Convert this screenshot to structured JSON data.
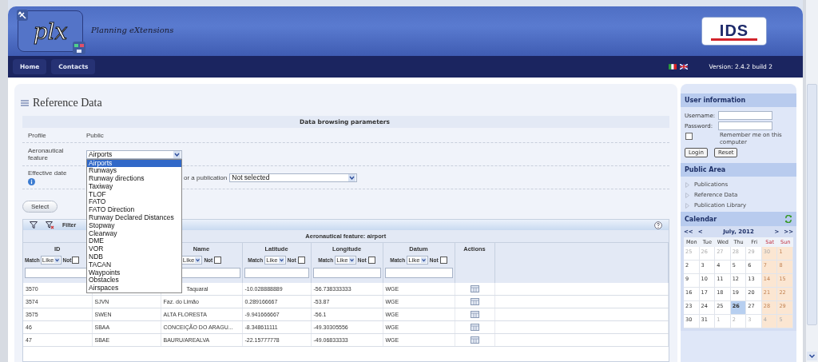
{
  "header": {
    "logo": "plx",
    "tagline": "Planning eXtensions",
    "brand": "IDS"
  },
  "nav": [
    {
      "label": "Home"
    },
    {
      "label": "Contacts"
    }
  ],
  "version": "Version: 2.4.2 build 2",
  "page_title": "Reference Data",
  "params": {
    "title": "Data browsing parameters",
    "profile_label": "Profile",
    "profile_value": "Public",
    "feature_label": "Aeronautical feature",
    "feature_value": "Airports",
    "feature_options": [
      {
        "label": "Airports",
        "selected": true
      },
      {
        "label": "Runways",
        "selected": false
      },
      {
        "label": "Runway directions",
        "selected": false
      },
      {
        "label": "Taxiway",
        "selected": false
      },
      {
        "label": "TLOF",
        "selected": false
      },
      {
        "label": "FATO",
        "selected": false
      },
      {
        "label": "FATO Direction",
        "selected": false
      },
      {
        "label": "Runway Declared Distances",
        "selected": false
      },
      {
        "label": "Stopway",
        "selected": false
      },
      {
        "label": "Clearway",
        "selected": false
      },
      {
        "label": "DME",
        "selected": false
      },
      {
        "label": "VOR",
        "selected": false
      },
      {
        "label": "NDB",
        "selected": false
      },
      {
        "label": "TACAN",
        "selected": false
      },
      {
        "label": "Waypoints",
        "selected": false
      },
      {
        "label": "Obstacles",
        "selected": false
      },
      {
        "label": "Airspaces",
        "selected": false
      }
    ],
    "date_label": "Effective date",
    "publication_label": "or a publication",
    "publication_value": "Not selected",
    "select_button": "Select"
  },
  "table": {
    "toolbar_label": "Filter",
    "caption": "Aeronautical feature: airport",
    "columns": [
      {
        "title": "ID",
        "filter": {
          "match": "Match",
          "op": "Like",
          "not": "Not",
          "not_checked": false
        }
      },
      {},
      {
        "title": "Name",
        "filter": {
          "op": "Like",
          "not": "Not",
          "not_checked": false
        }
      },
      {
        "title": "Latitude",
        "filter": {
          "match": "Match",
          "op": "Like",
          "not": "Not",
          "not_checked": false
        }
      },
      {
        "title": "Longitude",
        "filter": {
          "match": "Match",
          "op": "Like",
          "not": "Not",
          "not_checked": false
        }
      },
      {
        "title": "Datum",
        "filter": {
          "match": "Match",
          "op": "Like",
          "not": "Not",
          "not_checked": false
        }
      },
      {
        "title": "Actions"
      }
    ],
    "rows": [
      {
        "cells": [
          "3570",
          "",
          "Taquaral",
          "-10.028888889",
          "-56.738333333",
          "WGE"
        ]
      },
      {
        "cells": [
          "3574",
          "SJVN",
          "Faz. do Limão",
          "0.289166667",
          "-53.87",
          "WGE"
        ]
      },
      {
        "cells": [
          "3575",
          "SWEN",
          "ALTA FLORESTA",
          "-9.941666667",
          "-56.1",
          "WGE"
        ]
      },
      {
        "cells": [
          "46",
          "SBAA",
          "CONCEIÇÃO DO ARAGU...",
          "-8.348611111",
          "-49.30305556",
          "WGE"
        ]
      },
      {
        "cells": [
          "47",
          "SBAE",
          "BAURU/AREALVA",
          "-22.15777778",
          "-49.06833333",
          "WGE"
        ]
      }
    ]
  },
  "user_info": {
    "title": "User information",
    "username_label": "Username:",
    "password_label": "Password:",
    "remember": "Remember me on this computer",
    "remember_checked": false,
    "login": "Login",
    "reset": "Reset"
  },
  "public_area": {
    "title": "Public Area",
    "links": [
      "Publications",
      "Reference Data",
      "Publication Library"
    ]
  },
  "calendar": {
    "title": "Calendar",
    "first": "<<",
    "prev": "<",
    "month": "July, 2012",
    "next": ">",
    "last": ">>",
    "weekdays": [
      "Mon",
      "Tue",
      "Wed",
      "Thu",
      "Fri",
      "Sat",
      "Sun"
    ],
    "weeks": [
      [
        {
          "d": "25",
          "other": true,
          "selected": false
        },
        {
          "d": "26",
          "other": true,
          "selected": false
        },
        {
          "d": "27",
          "other": true,
          "selected": false
        },
        {
          "d": "28",
          "other": true,
          "selected": false
        },
        {
          "d": "29",
          "other": true,
          "selected": false
        },
        {
          "d": "30",
          "other": true,
          "selected": false
        },
        {
          "d": "1",
          "other": false,
          "selected": false
        }
      ],
      [
        {
          "d": "2",
          "other": false,
          "selected": false
        },
        {
          "d": "3",
          "other": false,
          "selected": false
        },
        {
          "d": "4",
          "other": false,
          "selected": false
        },
        {
          "d": "5",
          "other": false,
          "selected": false
        },
        {
          "d": "6",
          "other": false,
          "selected": false
        },
        {
          "d": "7",
          "other": false,
          "selected": false
        },
        {
          "d": "8",
          "other": false,
          "selected": false
        }
      ],
      [
        {
          "d": "9",
          "other": false,
          "selected": false
        },
        {
          "d": "10",
          "other": false,
          "selected": false
        },
        {
          "d": "11",
          "other": false,
          "selected": false
        },
        {
          "d": "12",
          "other": false,
          "selected": false
        },
        {
          "d": "13",
          "other": false,
          "selected": false
        },
        {
          "d": "14",
          "other": false,
          "selected": false
        },
        {
          "d": "15",
          "other": false,
          "selected": false
        }
      ],
      [
        {
          "d": "16",
          "other": false,
          "selected": false
        },
        {
          "d": "17",
          "other": false,
          "selected": false
        },
        {
          "d": "18",
          "other": false,
          "selected": false
        },
        {
          "d": "19",
          "other": false,
          "selected": false
        },
        {
          "d": "20",
          "other": false,
          "selected": false
        },
        {
          "d": "21",
          "other": false,
          "selected": false
        },
        {
          "d": "22",
          "other": false,
          "selected": false
        }
      ],
      [
        {
          "d": "23",
          "other": false,
          "selected": false
        },
        {
          "d": "24",
          "other": false,
          "selected": false
        },
        {
          "d": "25",
          "other": false,
          "selected": false
        },
        {
          "d": "26",
          "other": false,
          "selected": true
        },
        {
          "d": "27",
          "other": false,
          "selected": false
        },
        {
          "d": "28",
          "other": false,
          "selected": false
        },
        {
          "d": "29",
          "other": false,
          "selected": false
        }
      ],
      [
        {
          "d": "30",
          "other": false,
          "selected": false
        },
        {
          "d": "31",
          "other": false,
          "selected": false
        },
        {
          "d": "1",
          "other": true,
          "selected": false
        },
        {
          "d": "2",
          "other": true,
          "selected": false
        },
        {
          "d": "3",
          "other": true,
          "selected": false
        },
        {
          "d": "4",
          "other": true,
          "selected": false
        },
        {
          "d": "5",
          "other": true,
          "selected": false
        }
      ]
    ]
  }
}
